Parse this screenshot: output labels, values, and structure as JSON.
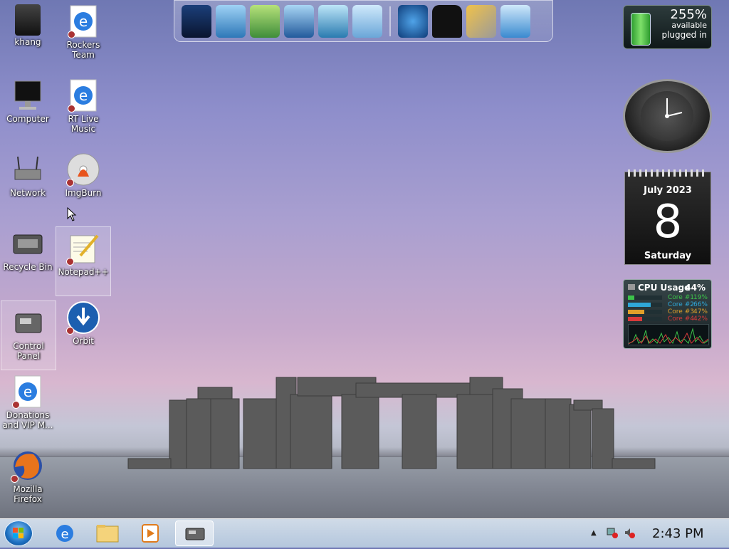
{
  "desktop": {
    "icons": [
      {
        "label": "khang"
      },
      {
        "label": "Rockers Team"
      },
      {
        "label": "Computer"
      },
      {
        "label": "RT Live Music"
      },
      {
        "label": "Network"
      },
      {
        "label": "ImgBurn"
      },
      {
        "label": "Recycle Bin"
      },
      {
        "label": "Notepad++"
      },
      {
        "label": "Control Panel"
      },
      {
        "label": "Orbit"
      },
      {
        "label": "Donations and VIP M..."
      },
      {
        "label": "Mozilla Firefox"
      }
    ]
  },
  "gadgets": {
    "battery": {
      "percent": "255%",
      "available": "available",
      "status": "plugged in"
    },
    "calendar": {
      "month_year": "July 2023",
      "day": "8",
      "weekday": "Saturday"
    },
    "cpu": {
      "title": "CPU Usage",
      "total": "44%",
      "cores": [
        {
          "name": "Core #1",
          "value": "19%",
          "color": "#3cc34a",
          "level": 0.19
        },
        {
          "name": "Core #2",
          "value": "66%",
          "color": "#2fa8d8",
          "level": 0.66
        },
        {
          "name": "Core #3",
          "value": "47%",
          "color": "#e0a02a",
          "level": 0.47
        },
        {
          "name": "Core #4",
          "value": "42%",
          "color": "#d83a3a",
          "level": 0.42
        }
      ]
    }
  },
  "taskbar": {
    "time": "2:43 PM",
    "tray_arrow": "▲"
  }
}
